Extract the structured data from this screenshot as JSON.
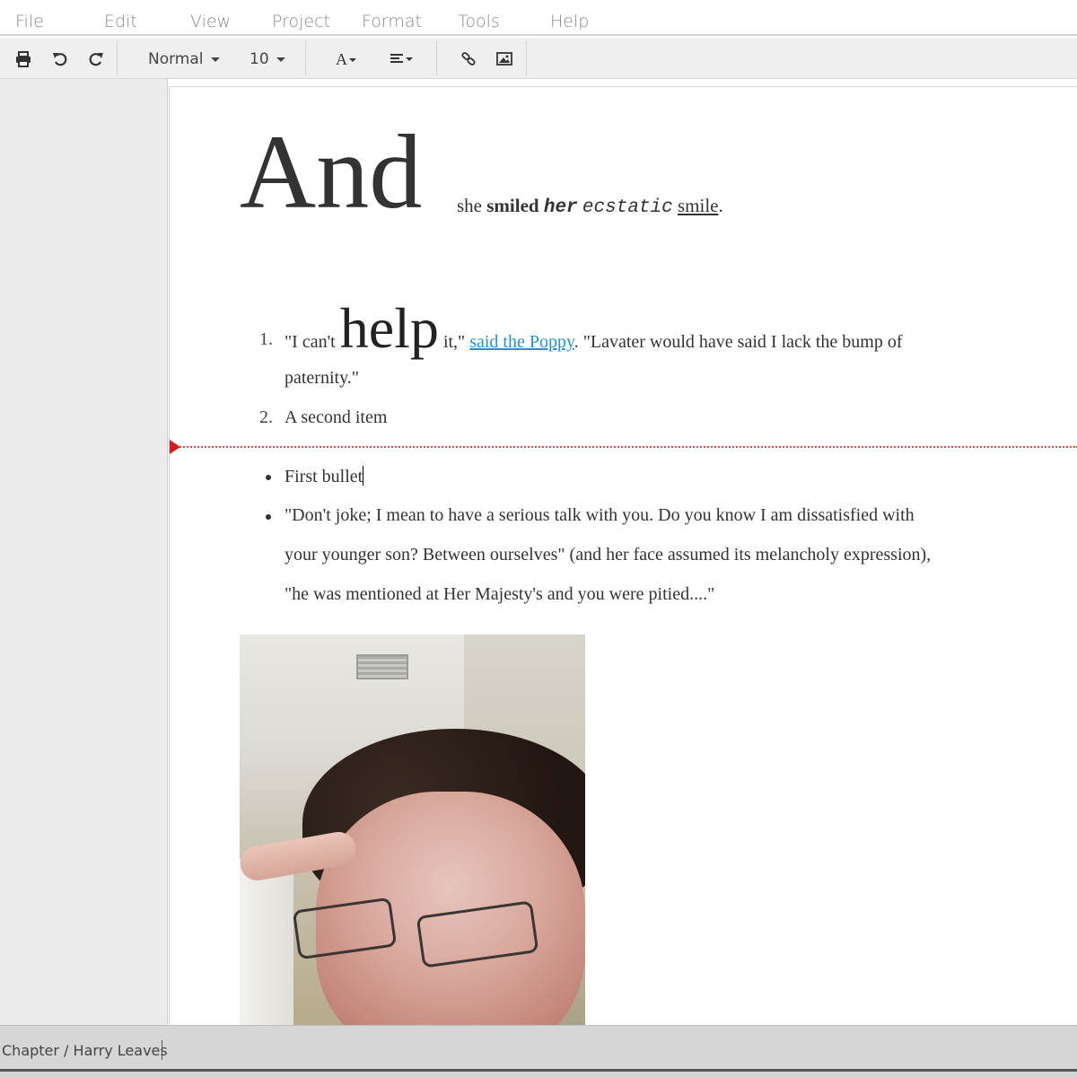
{
  "menu": {
    "items": [
      "File",
      "Edit",
      "View",
      "Project",
      "Format",
      "Tools",
      "Help"
    ]
  },
  "toolbar": {
    "style_value": "Normal",
    "size_value": "10",
    "icons": [
      "print-icon",
      "undo-icon",
      "redo-icon",
      "font-style-icon",
      "align-icon",
      "link-icon",
      "image-icon"
    ]
  },
  "document": {
    "drop_word": "And",
    "intro": {
      "she": "she",
      "smiled": "smiled",
      "her": "her",
      "ecstatic": "ecstatic",
      "smile": "smile",
      "period": "."
    },
    "ordered_list": [
      {
        "number": "1.",
        "pre": "\"I can't",
        "big": "help",
        "post": "it,\"",
        "link": "said the Poppy",
        "rest": ". \"Lavater would have said I lack the bump of",
        "cont": "paternity.\""
      },
      {
        "number": "2.",
        "text": "A second item"
      }
    ],
    "bullets": [
      {
        "text": "First bullet"
      },
      {
        "line1": "\"Don't joke; I mean to have a serious talk with you. Do you know I am dissatisfied with",
        "line2": "your younger son? Between ourselves\" (and her face assumed its melancholy expression),",
        "line3": "\"he was mentioned at Her Majesty's and you were pitied....\""
      }
    ]
  },
  "status": {
    "path": "Chapter / Harry Leaves"
  },
  "colors": {
    "link": "#2a8fd0",
    "page_break": "#e84a4a",
    "break_marker": "#e0181e"
  }
}
